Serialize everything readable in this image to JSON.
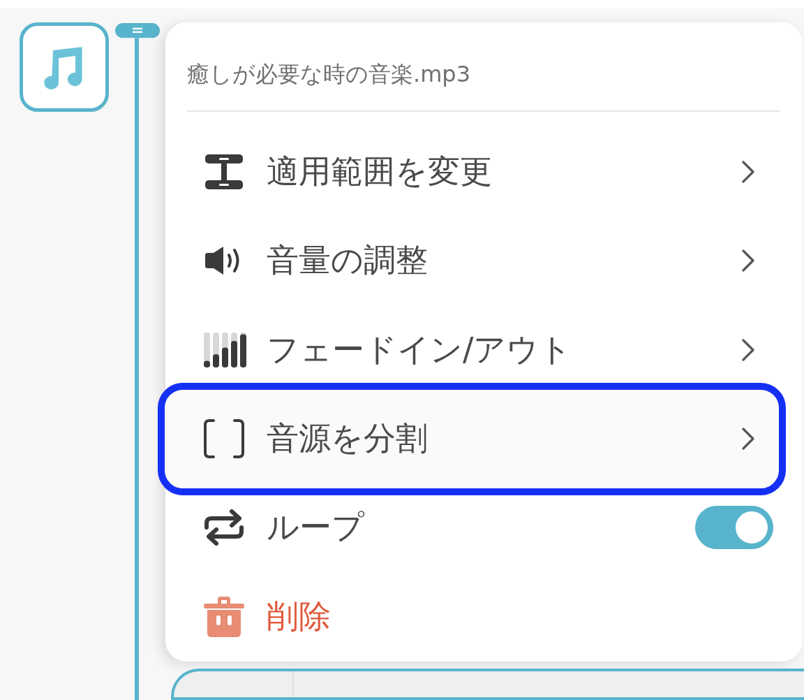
{
  "menu": {
    "title": "癒しが必要な時の音楽.mp3",
    "items": [
      {
        "kind": "submenu",
        "label": "適用範囲を変更",
        "highlighted": false
      },
      {
        "kind": "submenu",
        "label": "音量の調整",
        "highlighted": false
      },
      {
        "kind": "submenu",
        "label": "フェードイン/アウト",
        "highlighted": false
      },
      {
        "kind": "submenu",
        "label": "音源を分割",
        "highlighted": true
      },
      {
        "kind": "toggle",
        "label": "ループ",
        "on": true,
        "highlighted": false
      },
      {
        "kind": "danger",
        "label": "削除",
        "highlighted": false
      }
    ]
  }
}
